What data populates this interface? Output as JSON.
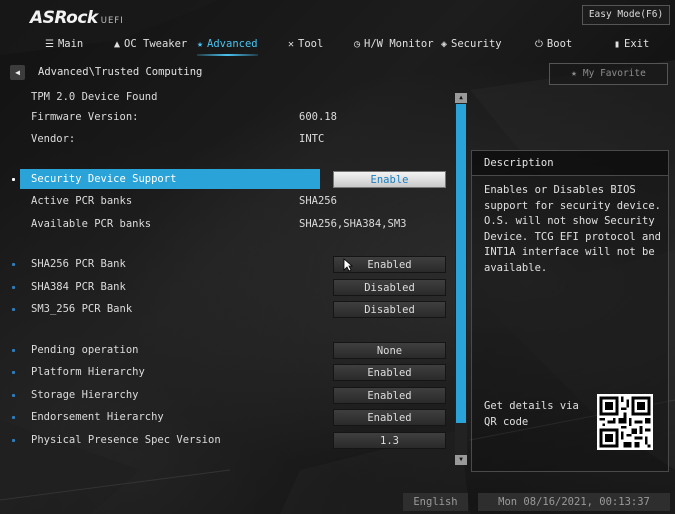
{
  "header": {
    "brand": "ASRock",
    "brand_suffix": "UEFI",
    "easy_mode_label": "Easy Mode(F6)"
  },
  "tabs": [
    {
      "label": "Main",
      "icon": "list-icon"
    },
    {
      "label": "OC Tweaker",
      "icon": "rocket-icon"
    },
    {
      "label": "Advanced",
      "icon": "star-icon",
      "active": true
    },
    {
      "label": "Tool",
      "icon": "tools-icon"
    },
    {
      "label": "H/W Monitor",
      "icon": "gauge-icon"
    },
    {
      "label": "Security",
      "icon": "shield-icon"
    },
    {
      "label": "Boot",
      "icon": "power-icon"
    },
    {
      "label": "Exit",
      "icon": "exit-door-icon"
    }
  ],
  "breadcrumb": "Advanced\\Trusted Computing",
  "favorite_label": "My Favorite",
  "settings": {
    "tpm_status": "TPM 2.0 Device Found",
    "firmware": {
      "label": "Firmware Version:",
      "value": "600.18"
    },
    "vendor": {
      "label": "Vendor:",
      "value": "INTC"
    },
    "security_device_support": {
      "label": "Security Device Support",
      "value": "Enable"
    },
    "active_pcr": {
      "label": "Active PCR banks",
      "value": "SHA256"
    },
    "available_pcr": {
      "label": "Available PCR banks",
      "value": "SHA256,SHA384,SM3"
    },
    "sha256_bank": {
      "label": "SHA256 PCR Bank",
      "value": "Enabled"
    },
    "sha384_bank": {
      "label": "SHA384 PCR Bank",
      "value": "Disabled"
    },
    "sm3_bank": {
      "label": "SM3_256 PCR Bank",
      "value": "Disabled"
    },
    "pending_op": {
      "label": "Pending operation",
      "value": "None"
    },
    "platform_hierarchy": {
      "label": "Platform Hierarchy",
      "value": "Enabled"
    },
    "storage_hierarchy": {
      "label": "Storage Hierarchy",
      "value": "Enabled"
    },
    "endorsement_hierarchy": {
      "label": "Endorsement Hierarchy",
      "value": "Enabled"
    },
    "pps_version": {
      "label": "Physical Presence Spec Version",
      "value": "1.3"
    }
  },
  "description": {
    "title": "Description",
    "text": "Enables or Disables BIOS support for security device. O.S. will not show Security Device. TCG EFI protocol and INT1A interface will not be available.",
    "qr_label": "Get details via QR code"
  },
  "footer": {
    "language": "English",
    "datetime": "Mon 08/16/2021, 00:13:37"
  },
  "colors": {
    "accent": "#2aa3d8",
    "tab_active": "#48c3f0",
    "text": "#dcdcdc"
  }
}
